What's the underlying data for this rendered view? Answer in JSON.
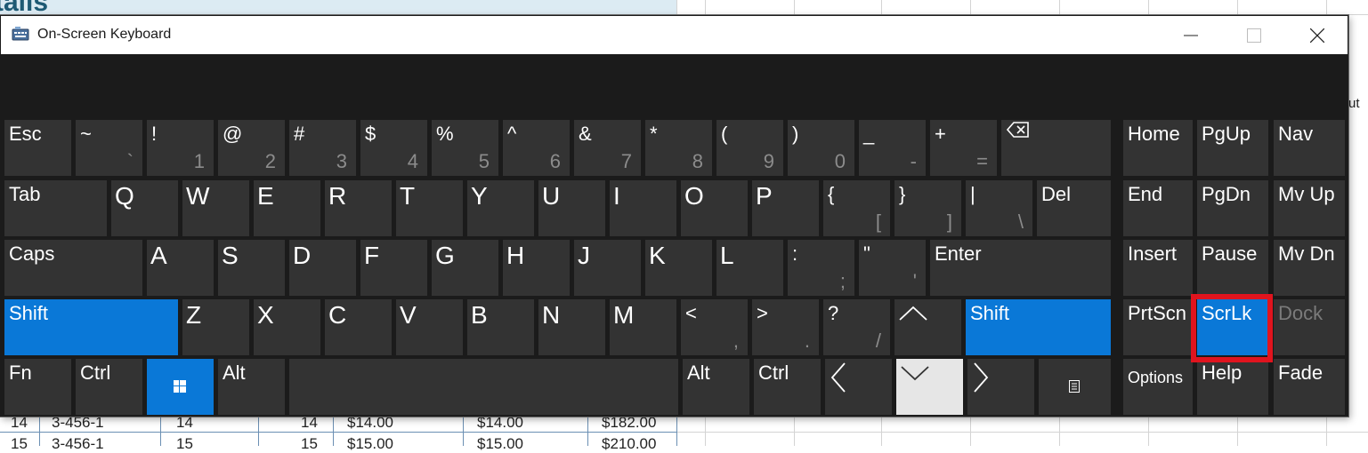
{
  "window": {
    "title": "On-Screen Keyboard",
    "controls": [
      "minimize",
      "maximize",
      "close"
    ]
  },
  "background": {
    "title_fragment": "tails",
    "right_fragment": "ut",
    "rows": [
      [
        "14",
        "3-456-1",
        "14",
        "14",
        "$14.00",
        "$14.00",
        "$182.00"
      ],
      [
        "15",
        "3-456-1",
        "15",
        "15",
        "$15.00",
        "$15.00",
        "$210.00"
      ]
    ]
  },
  "keyboard": {
    "number_row": [
      {
        "id": "esc",
        "primary": "Esc"
      },
      {
        "id": "tilde",
        "primary": "~",
        "secondary": "`"
      },
      {
        "id": "1",
        "primary": "!",
        "secondary": "1"
      },
      {
        "id": "2",
        "primary": "@",
        "secondary": "2"
      },
      {
        "id": "3",
        "primary": "#",
        "secondary": "3"
      },
      {
        "id": "4",
        "primary": "$",
        "secondary": "4"
      },
      {
        "id": "5",
        "primary": "%",
        "secondary": "5"
      },
      {
        "id": "6",
        "primary": "^",
        "secondary": "6"
      },
      {
        "id": "7",
        "primary": "&",
        "secondary": "7"
      },
      {
        "id": "8",
        "primary": "*",
        "secondary": "8"
      },
      {
        "id": "9",
        "primary": "(",
        "secondary": "9"
      },
      {
        "id": "0",
        "primary": ")",
        "secondary": "0"
      },
      {
        "id": "minus",
        "primary": "_",
        "secondary": "-"
      },
      {
        "id": "equals",
        "primary": "+",
        "secondary": "="
      },
      {
        "id": "backspace",
        "icon": "backspace-icon"
      }
    ],
    "tab_row": [
      {
        "id": "tab",
        "primary": "Tab"
      },
      {
        "id": "q",
        "primary": "Q"
      },
      {
        "id": "w",
        "primary": "W"
      },
      {
        "id": "e",
        "primary": "E"
      },
      {
        "id": "r",
        "primary": "R"
      },
      {
        "id": "t",
        "primary": "T"
      },
      {
        "id": "y",
        "primary": "Y"
      },
      {
        "id": "u",
        "primary": "U"
      },
      {
        "id": "i",
        "primary": "I"
      },
      {
        "id": "o",
        "primary": "O"
      },
      {
        "id": "p",
        "primary": "P"
      },
      {
        "id": "lbracket",
        "primary": "{",
        "secondary": "["
      },
      {
        "id": "rbracket",
        "primary": "}",
        "secondary": "]"
      },
      {
        "id": "backslash",
        "primary": "|",
        "secondary": "\\"
      },
      {
        "id": "del",
        "primary": "Del"
      }
    ],
    "caps_row": [
      {
        "id": "caps",
        "primary": "Caps"
      },
      {
        "id": "a",
        "primary": "A"
      },
      {
        "id": "s",
        "primary": "S"
      },
      {
        "id": "d",
        "primary": "D"
      },
      {
        "id": "f",
        "primary": "F"
      },
      {
        "id": "g",
        "primary": "G"
      },
      {
        "id": "h",
        "primary": "H"
      },
      {
        "id": "j",
        "primary": "J"
      },
      {
        "id": "k",
        "primary": "K"
      },
      {
        "id": "l",
        "primary": "L"
      },
      {
        "id": "semicolon",
        "primary": ":",
        "secondary": ";"
      },
      {
        "id": "quote",
        "primary": "\"",
        "secondary": "'"
      },
      {
        "id": "enter",
        "primary": "Enter"
      }
    ],
    "shift_row": [
      {
        "id": "lshift",
        "primary": "Shift",
        "active": true
      },
      {
        "id": "z",
        "primary": "Z"
      },
      {
        "id": "x",
        "primary": "X"
      },
      {
        "id": "c",
        "primary": "C"
      },
      {
        "id": "v",
        "primary": "V"
      },
      {
        "id": "b",
        "primary": "B"
      },
      {
        "id": "n",
        "primary": "N"
      },
      {
        "id": "m",
        "primary": "M"
      },
      {
        "id": "comma",
        "primary": "<",
        "secondary": ","
      },
      {
        "id": "period",
        "primary": ">",
        "secondary": "."
      },
      {
        "id": "slash",
        "primary": "?",
        "secondary": "/"
      },
      {
        "id": "up",
        "icon": "arrow-up-icon"
      },
      {
        "id": "rshift",
        "primary": "Shift",
        "active": true
      }
    ],
    "bottom_row": [
      {
        "id": "fn",
        "primary": "Fn"
      },
      {
        "id": "lctrl",
        "primary": "Ctrl"
      },
      {
        "id": "win",
        "icon": "windows-icon",
        "active": true
      },
      {
        "id": "lalt",
        "primary": "Alt"
      },
      {
        "id": "space",
        "primary": ""
      },
      {
        "id": "ralt",
        "primary": "Alt"
      },
      {
        "id": "rctrl",
        "primary": "Ctrl"
      },
      {
        "id": "left",
        "icon": "arrow-left-icon"
      },
      {
        "id": "down",
        "icon": "arrow-down-icon",
        "pressed": true
      },
      {
        "id": "right",
        "icon": "arrow-right-icon"
      },
      {
        "id": "menu",
        "icon": "context-menu-icon"
      }
    ],
    "nav_block": [
      {
        "id": "home",
        "primary": "Home"
      },
      {
        "id": "pgup",
        "primary": "PgUp"
      },
      {
        "id": "nav",
        "primary": "Nav"
      },
      {
        "id": "end",
        "primary": "End"
      },
      {
        "id": "pgdn",
        "primary": "PgDn"
      },
      {
        "id": "mvup",
        "primary": "Mv Up"
      },
      {
        "id": "insert",
        "primary": "Insert"
      },
      {
        "id": "pause",
        "primary": "Pause"
      },
      {
        "id": "mvdn",
        "primary": "Mv Dn"
      },
      {
        "id": "prtscn",
        "primary": "PrtScn"
      },
      {
        "id": "scrlk",
        "primary": "ScrLk",
        "active": true,
        "highlighted": true
      },
      {
        "id": "dock",
        "primary": "Dock",
        "disabled": true
      },
      {
        "id": "options",
        "primary": "Options"
      },
      {
        "id": "help",
        "primary": "Help"
      },
      {
        "id": "fade",
        "primary": "Fade"
      }
    ]
  },
  "colors": {
    "key_bg": "#333333",
    "key_active": "#0a78d7",
    "key_pressed": "#e6e6e6",
    "window_bg": "#1b1b1b",
    "highlight": "#e0141e"
  }
}
